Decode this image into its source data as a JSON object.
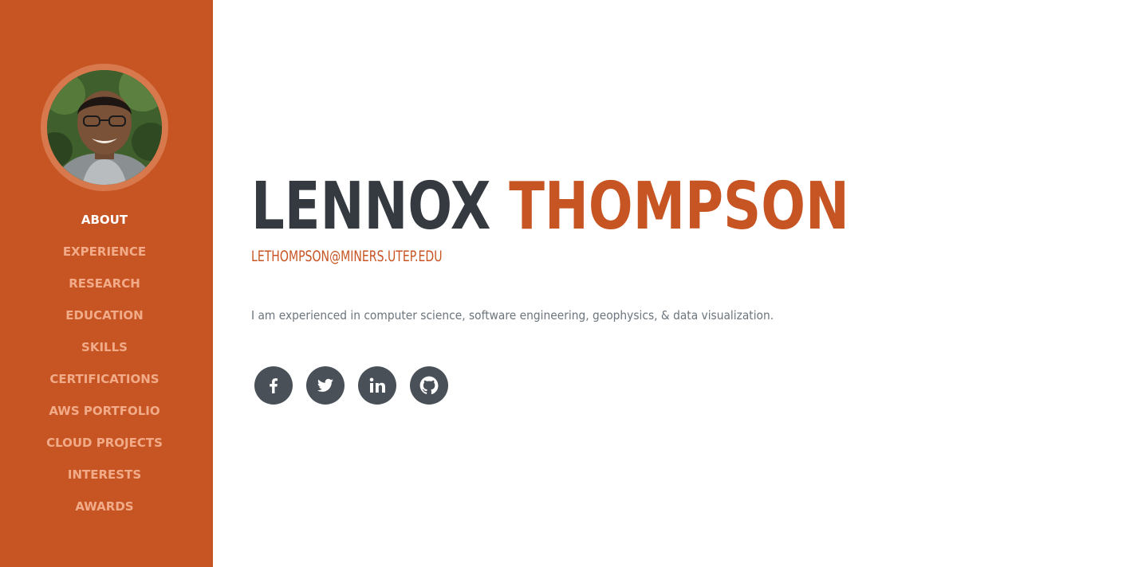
{
  "profile": {
    "first_name": "LENNOX",
    "last_name": "THOMPSON",
    "email": "LETHOMPSON@MINERS.UTEP.EDU",
    "bio": "I am experienced in computer science, software engineering, geophysics, & data visualization."
  },
  "nav": {
    "items": [
      {
        "label": "ABOUT",
        "active": true
      },
      {
        "label": "EXPERIENCE"
      },
      {
        "label": "RESEARCH"
      },
      {
        "label": "EDUCATION"
      },
      {
        "label": "SKILLS"
      },
      {
        "label": "CERTIFICATIONS"
      },
      {
        "label": "AWS PORTFOLIO"
      },
      {
        "label": "CLOUD PROJECTS"
      },
      {
        "label": "INTERESTS"
      },
      {
        "label": "AWARDS"
      }
    ]
  },
  "socials": [
    {
      "icon": "facebook-icon"
    },
    {
      "icon": "twitter-icon"
    },
    {
      "icon": "linkedin-icon"
    },
    {
      "icon": "github-icon"
    }
  ],
  "colors": {
    "sidebar": "#c75523",
    "accent": "#c75523",
    "nav_text": "#f1ab89",
    "nav_active": "#ffffff",
    "heading_dark": "#343a40",
    "bio_text": "#6c757d",
    "social_bg": "#495057"
  }
}
